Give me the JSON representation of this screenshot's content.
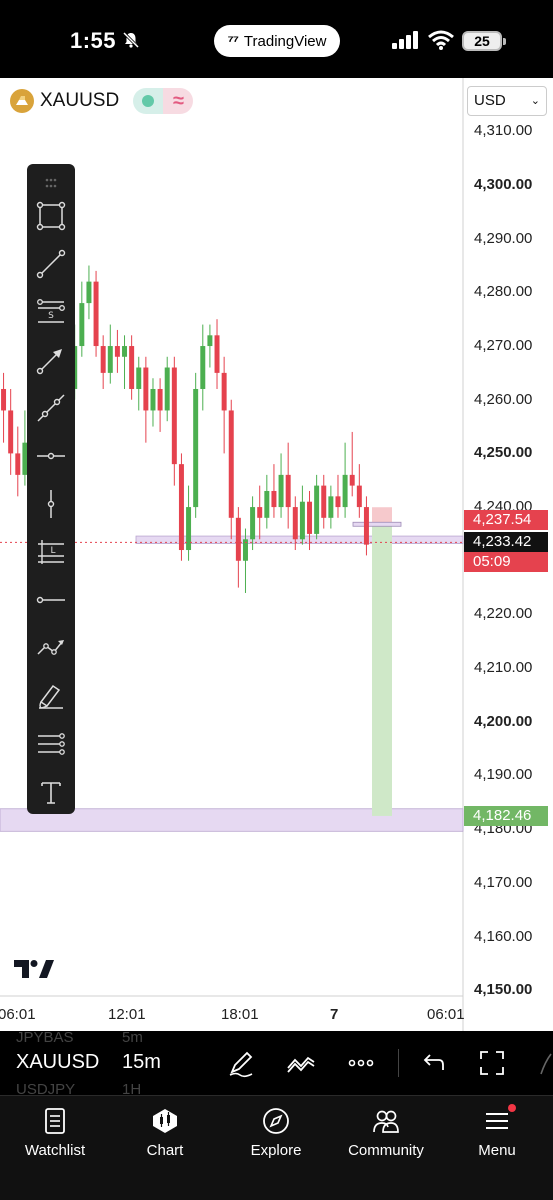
{
  "status_bar": {
    "time": "1:55",
    "app_pill": "TradingView",
    "battery": "25"
  },
  "header": {
    "symbol": "XAUUSD",
    "currency": "USD"
  },
  "price_axis": {
    "labels": [
      {
        "text": "4,310.00",
        "bold": false,
        "price": 4310
      },
      {
        "text": "4,300.00",
        "bold": true,
        "price": 4300
      },
      {
        "text": "4,290.00",
        "bold": false,
        "price": 4290
      },
      {
        "text": "4,280.00",
        "bold": false,
        "price": 4280
      },
      {
        "text": "4,270.00",
        "bold": false,
        "price": 4270
      },
      {
        "text": "4,260.00",
        "bold": false,
        "price": 4260
      },
      {
        "text": "4,250.00",
        "bold": true,
        "price": 4250
      },
      {
        "text": "4,240.00",
        "bold": false,
        "price": 4240
      },
      {
        "text": "4,230.00",
        "bold": false,
        "price": 4230
      },
      {
        "text": "4,220.00",
        "bold": false,
        "price": 4220
      },
      {
        "text": "4,210.00",
        "bold": false,
        "price": 4210
      },
      {
        "text": "4,200.00",
        "bold": true,
        "price": 4200
      },
      {
        "text": "4,190.00",
        "bold": false,
        "price": 4190
      },
      {
        "text": "4,180.00",
        "bold": false,
        "price": 4180
      },
      {
        "text": "4,170.00",
        "bold": false,
        "price": 4170
      },
      {
        "text": "4,160.00",
        "bold": false,
        "price": 4160
      },
      {
        "text": "4,150.00",
        "bold": true,
        "price": 4150
      }
    ],
    "tags": {
      "stop": {
        "text": "4,237.54",
        "price": 4237.54
      },
      "last": {
        "text": "4,233.42",
        "price": 4233.42
      },
      "countdown": {
        "text": "05:09"
      },
      "target": {
        "text": "4,182.46",
        "price": 4182.46
      }
    }
  },
  "time_axis": {
    "labels": [
      {
        "text": "06:01",
        "bold": false
      },
      {
        "text": "12:01",
        "bold": false
      },
      {
        "text": "18:01",
        "bold": false
      },
      {
        "text": "7",
        "bold": true
      },
      {
        "text": "06:01",
        "bold": false
      }
    ]
  },
  "toolbar": {
    "tools": [
      "drag-handle-icon",
      "rectangle-icon",
      "trend-line-icon",
      "parallel-channel-icon",
      "arrow-icon",
      "extended-line-icon",
      "horizontal-line-icon",
      "vertical-line-icon",
      "long-position-icon",
      "horizontal-ray-icon",
      "path-icon",
      "brush-icon",
      "pitchfork-icon",
      "text-icon"
    ]
  },
  "sub_bar": {
    "symbol": "XAUUSD",
    "interval": "15m",
    "ghost_above": {
      "symbol": "JPYBAS",
      "interval": "5m"
    },
    "ghost_below": {
      "symbol": "USDJPY",
      "interval": "1H"
    }
  },
  "tabs": [
    {
      "label": "Watchlist",
      "icon": "watchlist-icon"
    },
    {
      "label": "Chart",
      "icon": "chart-icon"
    },
    {
      "label": "Explore",
      "icon": "compass-icon"
    },
    {
      "label": "Community",
      "icon": "community-icon"
    },
    {
      "label": "Menu",
      "icon": "menu-icon"
    }
  ],
  "colors": {
    "up": "#4caf50",
    "down": "#e5424e",
    "zone": "#e6d9f2",
    "target_zone": "#cfe8c8",
    "stop_zone": "#f6c9cc"
  },
  "chart_data": {
    "type": "candlestick",
    "symbol": "XAUUSD",
    "interval": "15m",
    "ylim": [
      4150,
      4312
    ],
    "x_tick_labels": [
      "06:01",
      "12:01",
      "18:01",
      "7",
      "06:01"
    ],
    "candles": [
      [
        4262,
        4258,
        4265,
        4252
      ],
      [
        4258,
        4250,
        4262,
        4246
      ],
      [
        4250,
        4246,
        4255,
        4242
      ],
      [
        4246,
        4252,
        4258,
        4244
      ],
      [
        4252,
        4259,
        4262,
        4248
      ],
      [
        4259,
        4251,
        4264,
        4249
      ],
      [
        4251,
        4257,
        4260,
        4248
      ],
      [
        4257,
        4248,
        4259,
        4244
      ],
      [
        4248,
        4243,
        4251,
        4240
      ],
      [
        4243,
        4262,
        4264,
        4242
      ],
      [
        4262,
        4270,
        4274,
        4260
      ],
      [
        4270,
        4278,
        4282,
        4268
      ],
      [
        4278,
        4282,
        4285,
        4275
      ],
      [
        4282,
        4270,
        4284,
        4268
      ],
      [
        4270,
        4265,
        4272,
        4262
      ],
      [
        4265,
        4270,
        4274,
        4263
      ],
      [
        4270,
        4268,
        4273,
        4265
      ],
      [
        4268,
        4270,
        4272,
        4262
      ],
      [
        4270,
        4262,
        4272,
        4260
      ],
      [
        4262,
        4266,
        4268,
        4258
      ],
      [
        4266,
        4258,
        4268,
        4252
      ],
      [
        4258,
        4262,
        4264,
        4255
      ],
      [
        4262,
        4258,
        4264,
        4254
      ],
      [
        4258,
        4266,
        4268,
        4256
      ],
      [
        4266,
        4248,
        4268,
        4244
      ],
      [
        4248,
        4232,
        4250,
        4230
      ],
      [
        4232,
        4240,
        4244,
        4230
      ],
      [
        4240,
        4262,
        4265,
        4238
      ],
      [
        4262,
        4270,
        4274,
        4258
      ],
      [
        4270,
        4272,
        4274,
        4266
      ],
      [
        4272,
        4265,
        4275,
        4262
      ],
      [
        4265,
        4258,
        4268,
        4250
      ],
      [
        4258,
        4238,
        4260,
        4234
      ],
      [
        4238,
        4230,
        4240,
        4225
      ],
      [
        4230,
        4234,
        4236,
        4224
      ],
      [
        4234,
        4240,
        4242,
        4232
      ],
      [
        4240,
        4238,
        4244,
        4234
      ],
      [
        4238,
        4243,
        4246,
        4236
      ],
      [
        4243,
        4240,
        4248,
        4238
      ],
      [
        4240,
        4246,
        4250,
        4238
      ],
      [
        4246,
        4240,
        4252,
        4236
      ],
      [
        4240,
        4234,
        4242,
        4232
      ],
      [
        4234,
        4241,
        4244,
        4233
      ],
      [
        4241,
        4235,
        4243,
        4232
      ],
      [
        4235,
        4244,
        4246,
        4234
      ],
      [
        4244,
        4238,
        4246,
        4236
      ],
      [
        4238,
        4242,
        4244,
        4236
      ],
      [
        4242,
        4240,
        4246,
        4238
      ],
      [
        4240,
        4246,
        4252,
        4238
      ],
      [
        4246,
        4244,
        4254,
        4242
      ],
      [
        4244,
        4240,
        4248,
        4238
      ],
      [
        4240,
        4233,
        4242,
        4231
      ]
    ],
    "horizontal_zones": [
      {
        "from": 4233.2,
        "to": 4234.6
      },
      {
        "from": 4179.6,
        "to": 4183.8
      }
    ],
    "position": {
      "type": "long",
      "entry": 4236.8,
      "stop": 4239.6,
      "target": 4182.46
    }
  }
}
